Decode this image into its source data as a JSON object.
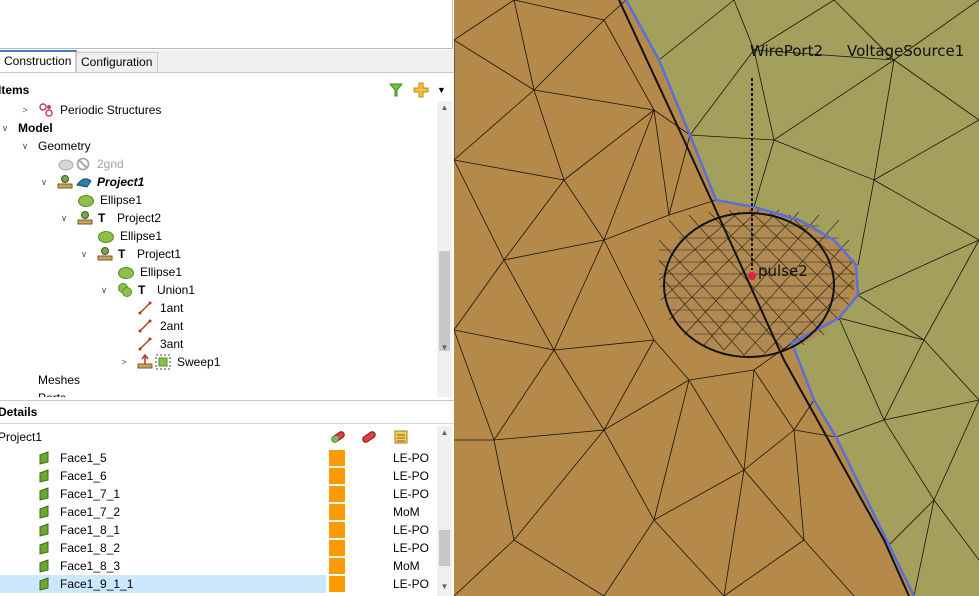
{
  "tabs": [
    {
      "label": "Construction",
      "active": true
    },
    {
      "label": "Configuration",
      "active": false
    }
  ],
  "items_header": "Items",
  "details_header": "Details",
  "tree": {
    "periodic": "Periodic Structures",
    "model": "Model",
    "geometry": "Geometry",
    "gnd": "2gnd",
    "project1": "Project1",
    "ellipse1_a": "Ellipse1",
    "project2": "Project2",
    "ellipse1_b": "Ellipse1",
    "project1_b": "Project1",
    "ellipse1_c": "Ellipse1",
    "union1": "Union1",
    "ant1": "1ant",
    "ant2": "2ant",
    "ant3": "3ant",
    "sweep1": "Sweep1",
    "meshes": "Meshes",
    "ports": "Ports",
    "t_label": "T"
  },
  "details": {
    "title": "Project1",
    "rows": [
      {
        "name": "Face1_5",
        "solver": "LE-PO",
        "selected": false
      },
      {
        "name": "Face1_6",
        "solver": "LE-PO",
        "selected": false
      },
      {
        "name": "Face1_7_1",
        "solver": "LE-PO",
        "selected": false
      },
      {
        "name": "Face1_7_2",
        "solver": "MoM",
        "selected": false
      },
      {
        "name": "Face1_8_1",
        "solver": "LE-PO",
        "selected": false
      },
      {
        "name": "Face1_8_2",
        "solver": "LE-PO",
        "selected": false
      },
      {
        "name": "Face1_8_3",
        "solver": "MoM",
        "selected": false
      },
      {
        "name": "Face1_9_1_1",
        "solver": "LE-PO",
        "selected": true
      }
    ]
  },
  "viewport": {
    "label_wireport": "WirePort2",
    "label_source": "VoltageSource1",
    "label_pulse": "pulse2"
  },
  "colors": {
    "accent": "#3c7fc2",
    "face_orange": "#ff9900",
    "mesh_brown": "#b4894a",
    "mesh_olive": "#a3a05e",
    "boundary_blue": "#5a6fd8",
    "selection": "#cce8ff"
  }
}
